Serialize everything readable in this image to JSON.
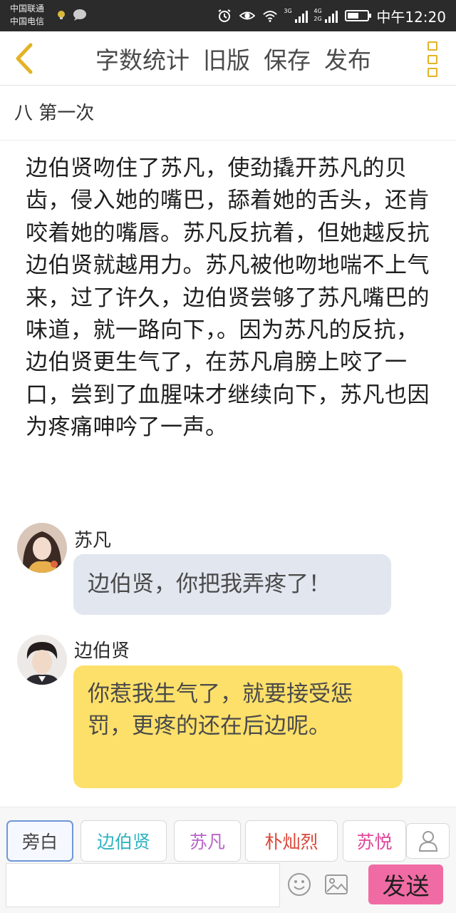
{
  "status_bar": {
    "carrier_1": "中国联通",
    "carrier_2": "中国电信",
    "network_1": "3G",
    "network_2": "4G",
    "network_3": "2G",
    "time": "中午12:20",
    "battery_level": 0.55
  },
  "toolbar": {
    "back_icon": "chevron-left-icon",
    "actions": [
      "字数统计",
      "旧版",
      "保存",
      "发布"
    ],
    "more_icon": "more-vertical-icon",
    "accent_color": "#e3b325"
  },
  "chapter": {
    "title": "八 第一次"
  },
  "narration": "边伯贤吻住了苏凡，使劲撬开苏凡的贝齿，侵入她的嘴巴，舔着她的舌头，还肯咬着她的嘴唇。苏凡反抗着，但她越反抗边伯贤就越用力。苏凡被他吻地喘不上气来，过了许久，边伯贤尝够了苏凡嘴巴的味道，就一路向下，。因为苏凡的反抗，边伯贤更生气了，在苏凡肩膀上咬了一口，尝到了血腥味才继续向下，苏凡也因为疼痛呻吟了一声。",
  "messages": [
    {
      "speaker": "苏凡",
      "text": "边伯贤，你把我弄疼了！",
      "bubble_color": "#e1e6ef"
    },
    {
      "speaker": "边伯贤",
      "text": "你惹我生气了，就要接受惩罚，更疼的还在后边呢。",
      "bubble_color": "#fde06a"
    }
  ],
  "role_tabs": [
    {
      "label": "旁白",
      "color": "#444444",
      "selected": true
    },
    {
      "label": "边伯贤",
      "color": "#2fb3c1"
    },
    {
      "label": "苏凡",
      "color": "#b765c9"
    },
    {
      "label": "朴灿烈",
      "color": "#d9473a"
    },
    {
      "label": "苏悦",
      "color": "#e0479a"
    }
  ],
  "composer": {
    "input_value": "",
    "emoji_icon": "smiley-icon",
    "image_icon": "image-icon",
    "profile_icon": "user-icon",
    "send_label": "发送",
    "send_color": "#f06ba3"
  }
}
